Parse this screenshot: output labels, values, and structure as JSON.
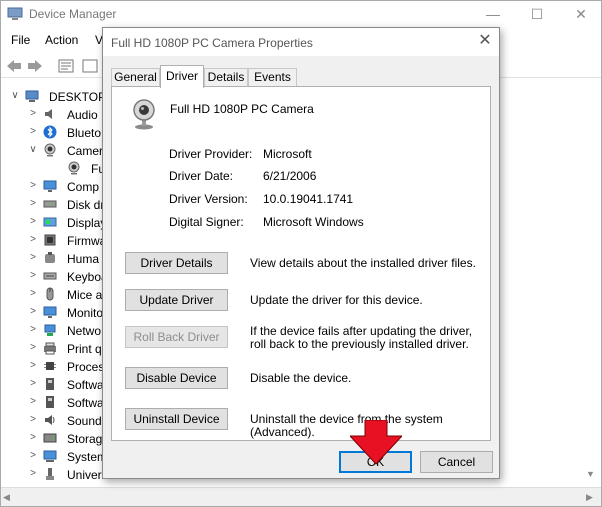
{
  "device_manager": {
    "title": "Device Manager",
    "menu": [
      "File",
      "Action",
      "V"
    ],
    "tree": [
      {
        "label": "DESKTOP-",
        "arrow": "∨",
        "icon": "computer-icon"
      },
      {
        "label": "Audio",
        "arrow": ">",
        "icon": "speaker-icon"
      },
      {
        "label": "Blueto",
        "arrow": ">",
        "icon": "bluetooth-icon"
      },
      {
        "label": "Camer",
        "arrow": "∨",
        "icon": "camera-icon"
      },
      {
        "label": "Ful",
        "arrow": "",
        "icon": "webcam-icon"
      },
      {
        "label": "Comp",
        "arrow": ">",
        "icon": "monitor-icon"
      },
      {
        "label": "Disk dr",
        "arrow": ">",
        "icon": "disk-icon"
      },
      {
        "label": "Display",
        "arrow": ">",
        "icon": "display-adapter-icon"
      },
      {
        "label": "Firmwa",
        "arrow": ">",
        "icon": "firmware-icon"
      },
      {
        "label": "Huma",
        "arrow": ">",
        "icon": "hid-icon"
      },
      {
        "label": "Keyboa",
        "arrow": ">",
        "icon": "keyboard-icon"
      },
      {
        "label": "Mice a",
        "arrow": ">",
        "icon": "mouse-icon"
      },
      {
        "label": "Monito",
        "arrow": ">",
        "icon": "monitor-icon"
      },
      {
        "label": "Netwo",
        "arrow": ">",
        "icon": "network-icon"
      },
      {
        "label": "Print q",
        "arrow": ">",
        "icon": "printer-icon"
      },
      {
        "label": "Proces",
        "arrow": ">",
        "icon": "processor-icon"
      },
      {
        "label": "Softwa",
        "arrow": ">",
        "icon": "software-icon"
      },
      {
        "label": "Softwa",
        "arrow": ">",
        "icon": "software-icon"
      },
      {
        "label": "Sound",
        "arrow": ">",
        "icon": "sound-icon"
      },
      {
        "label": "Storag",
        "arrow": ">",
        "icon": "storage-icon"
      },
      {
        "label": "System",
        "arrow": ">",
        "icon": "system-icon"
      },
      {
        "label": "Univer",
        "arrow": ">",
        "icon": "usb-icon"
      }
    ]
  },
  "dialog": {
    "title": "Full HD 1080P PC Camera Properties",
    "tabs": [
      "General",
      "Driver",
      "Details",
      "Events"
    ],
    "active_tab": "Driver",
    "device_name": "Full HD 1080P PC Camera",
    "info": [
      {
        "label": "Driver Provider:",
        "value": "Microsoft"
      },
      {
        "label": "Driver Date:",
        "value": "6/21/2006"
      },
      {
        "label": "Driver Version:",
        "value": "10.0.19041.1741"
      },
      {
        "label": "Digital Signer:",
        "value": "Microsoft Windows"
      }
    ],
    "actions": [
      {
        "label": "Driver Details",
        "desc": "View details about the installed driver files.",
        "enabled": true
      },
      {
        "label": "Update Driver",
        "desc": "Update the driver for this device.",
        "enabled": true
      },
      {
        "label": "Roll Back Driver",
        "desc": "If the device fails after updating the driver, roll back to the previously installed driver.",
        "enabled": false
      },
      {
        "label": "Disable Device",
        "desc": "Disable the device.",
        "enabled": true
      },
      {
        "label": "Uninstall Device",
        "desc": "Uninstall the device from the system (Advanced).",
        "enabled": true
      }
    ],
    "ok_label": "OK",
    "cancel_label": "Cancel"
  },
  "annotation": {
    "arrow_color": "#e81123"
  }
}
